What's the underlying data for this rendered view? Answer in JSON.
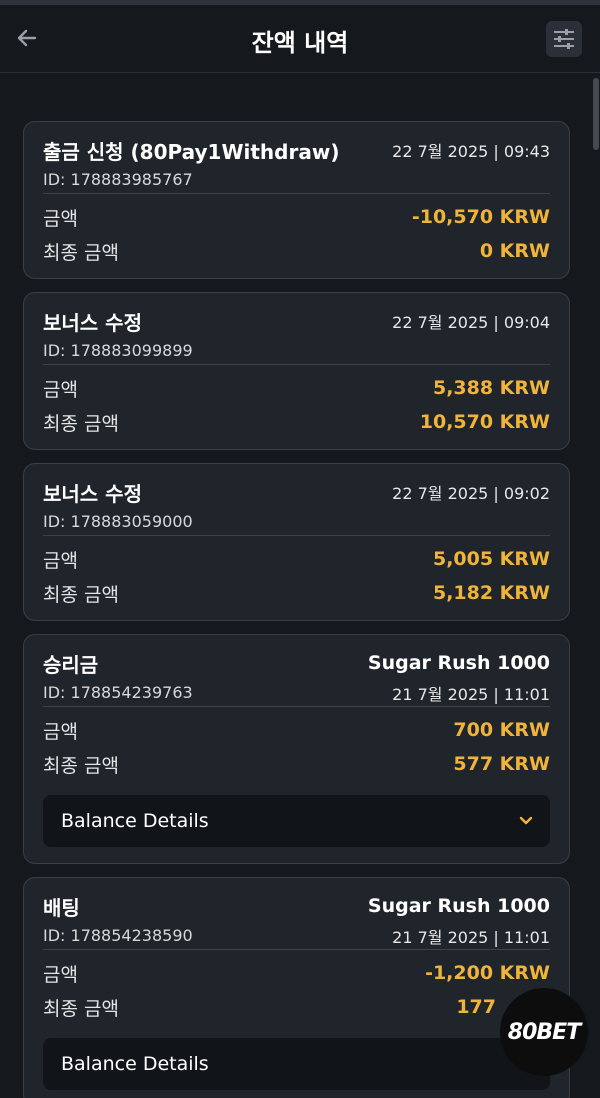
{
  "header": {
    "title": "잔액 내역",
    "back_icon": "arrow-left-icon",
    "filter_icon": "sliders-icon"
  },
  "colors": {
    "accent": "#f0b43a",
    "background": "#15181d",
    "card": "#20242b"
  },
  "transactions": [
    {
      "type": "출금 신청 (80Pay1Withdraw)",
      "right_top": "22 7월 2025 | 09:43",
      "id": "ID: 178883985767",
      "right_id": "",
      "amount_label": "금액",
      "amount": "-10,570 KRW",
      "final_label": "최종 금액",
      "final_amount": "0 KRW"
    },
    {
      "type": "보너스 수정",
      "right_top": "22 7월 2025 | 09:04",
      "id": "ID: 178883099899",
      "right_id": "",
      "amount_label": "금액",
      "amount": "5,388 KRW",
      "final_label": "최종 금액",
      "final_amount": "10,570 KRW"
    },
    {
      "type": "보너스 수정",
      "right_top": "22 7월 2025 | 09:02",
      "id": "ID: 178883059000",
      "right_id": "",
      "amount_label": "금액",
      "amount": "5,005 KRW",
      "final_label": "최종 금액",
      "final_amount": "5,182 KRW"
    },
    {
      "type": "승리금",
      "right_top": "Sugar Rush 1000",
      "id": "ID: 178854239763",
      "right_id": "21 7월 2025 | 11:01",
      "amount_label": "금액",
      "amount": "700 KRW",
      "final_label": "최종 금액",
      "final_amount": "577 KRW",
      "details_label": "Balance Details"
    },
    {
      "type": "배팅",
      "right_top": "Sugar Rush 1000",
      "id": "ID: 178854238590",
      "right_id": "21 7월 2025 | 11:01",
      "amount_label": "금액",
      "amount": "-1,200 KRW",
      "final_label": "최종 금액",
      "final_amount": "177",
      "details_label": "Balance Details"
    }
  ],
  "logo": {
    "text": "80BET"
  }
}
